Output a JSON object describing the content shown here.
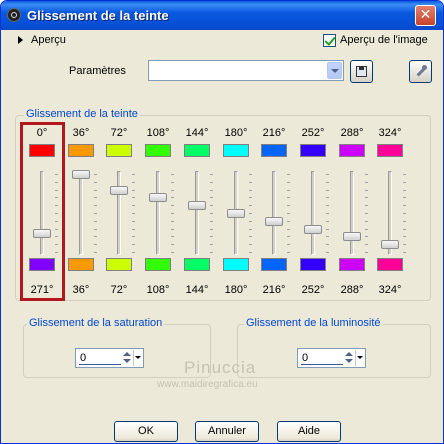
{
  "window": {
    "title": "Glissement de la teinte",
    "close_glyph": "✕"
  },
  "preview": {
    "toggle_label": "Aperçu",
    "image_preview_label": "Aperçu de l'image",
    "image_preview_checked": true
  },
  "params": {
    "label": "Paramètres",
    "value": "",
    "save_icon": "disk-icon",
    "options_icon": "wrench-icon"
  },
  "hue_group": {
    "label": "Glissement de la teinte",
    "channels": [
      {
        "label": "0°",
        "shifted_label": "271°",
        "color": "#ff0000",
        "shifted_color": "#8000ff",
        "level": 0.75
      },
      {
        "label": "36°",
        "shifted_label": "36°",
        "color": "#ff9900",
        "shifted_color": "#ff9900",
        "level": 0.0
      },
      {
        "label": "72°",
        "shifted_label": "72°",
        "color": "#ccff00",
        "shifted_color": "#ccff00",
        "level": 0.2
      },
      {
        "label": "108°",
        "shifted_label": "108°",
        "color": "#33ff00",
        "shifted_color": "#33ff00",
        "level": 0.3
      },
      {
        "label": "144°",
        "shifted_label": "144°",
        "color": "#00ff66",
        "shifted_color": "#00ff66",
        "level": 0.4
      },
      {
        "label": "180°",
        "shifted_label": "180°",
        "color": "#00ffff",
        "shifted_color": "#00ffff",
        "level": 0.5
      },
      {
        "label": "216°",
        "shifted_label": "216°",
        "color": "#0066ff",
        "shifted_color": "#0066ff",
        "level": 0.6
      },
      {
        "label": "252°",
        "shifted_label": "252°",
        "color": "#3300ff",
        "shifted_color": "#3300ff",
        "level": 0.7
      },
      {
        "label": "288°",
        "shifted_label": "288°",
        "color": "#cc00ff",
        "shifted_color": "#cc00ff",
        "level": 0.8
      },
      {
        "label": "324°",
        "shifted_label": "324°",
        "color": "#ff0099",
        "shifted_color": "#ff0099",
        "level": 0.9
      }
    ]
  },
  "saturation": {
    "label": "Glissement de la saturation",
    "value": "0"
  },
  "luminosity": {
    "label": "Glissement de la luminosité",
    "value": "0"
  },
  "watermark": {
    "line1": "Pinuccia",
    "line2": "www.maidiregrafica.eu"
  },
  "buttons": {
    "ok": "OK",
    "cancel": "Annuler",
    "help": "Aide"
  },
  "colors": {
    "titlebar": "#0a58e0",
    "dialog_bg": "#ece9d8",
    "group_label": "#0046d5",
    "highlight_box": "#b0181e"
  }
}
